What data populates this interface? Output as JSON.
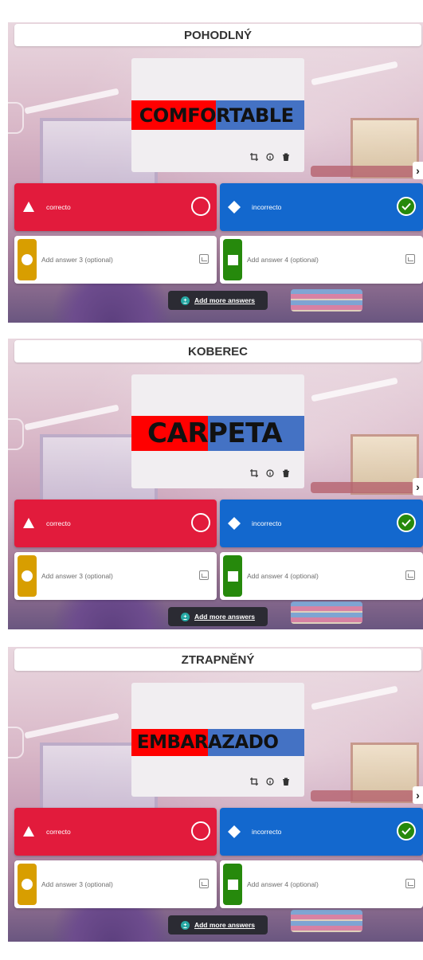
{
  "questions": [
    {
      "title": "POHODLNÝ",
      "image_word": {
        "red_part": "COMFO",
        "blue_part": "RTABLE"
      },
      "answers": [
        {
          "text": "correcto",
          "shape": "triangle",
          "color": "#e21b3c",
          "correct": false
        },
        {
          "text": "incorrecto",
          "shape": "diamond",
          "color": "#1368ce",
          "correct": true
        }
      ],
      "optional": [
        {
          "placeholder": "Add answer 3 (optional)",
          "shape": "circle",
          "color": "#d89e00"
        },
        {
          "placeholder": "Add answer 4 (optional)",
          "shape": "square",
          "color": "#26890c"
        }
      ],
      "add_more_label": "Add more answers"
    },
    {
      "title": "KOBEREC",
      "image_word": {
        "red_part": "CAR",
        "blue_part": "PETA"
      },
      "answers": [
        {
          "text": "correcto",
          "shape": "triangle",
          "color": "#e21b3c",
          "correct": false
        },
        {
          "text": "incorrecto",
          "shape": "diamond",
          "color": "#1368ce",
          "correct": true
        }
      ],
      "optional": [
        {
          "placeholder": "Add answer 3 (optional)",
          "shape": "circle",
          "color": "#d89e00"
        },
        {
          "placeholder": "Add answer 4 (optional)",
          "shape": "square",
          "color": "#26890c"
        }
      ],
      "add_more_label": "Add more answers"
    },
    {
      "title": "ZTRAPNĚNÝ",
      "image_word": {
        "red_part": "EMBAR",
        "blue_part": "AZADO"
      },
      "answers": [
        {
          "text": "correcto",
          "shape": "triangle",
          "color": "#e21b3c",
          "correct": false
        },
        {
          "text": "incorrecto",
          "shape": "diamond",
          "color": "#1368ce",
          "correct": true
        }
      ],
      "optional": [
        {
          "placeholder": "Add answer 3 (optional)",
          "shape": "circle",
          "color": "#d89e00"
        },
        {
          "placeholder": "Add answer 4 (optional)",
          "shape": "square",
          "color": "#26890c"
        }
      ],
      "add_more_label": "Add more answers"
    }
  ],
  "image_word_colors": {
    "red": "#ff0000",
    "blue": "#4472c4"
  },
  "icons": [
    "crop-icon",
    "info-icon",
    "trash-icon",
    "next-arrow-icon",
    "check-icon",
    "image-icon",
    "plus-icon"
  ]
}
